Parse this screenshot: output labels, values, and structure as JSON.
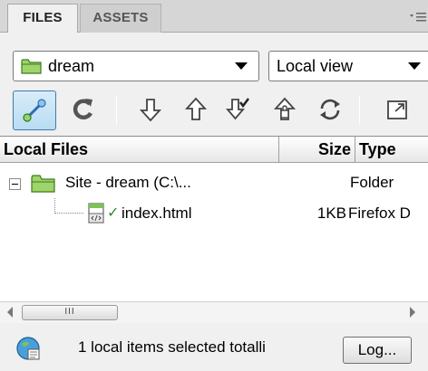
{
  "tabs": [
    {
      "label": "FILES",
      "active": true
    },
    {
      "label": "ASSETS",
      "active": false
    }
  ],
  "site_select": {
    "value": "dream",
    "icon": "folder-icon"
  },
  "view_select": {
    "value": "Local view"
  },
  "toolbar": {
    "buttons": [
      {
        "name": "connect-icon",
        "active": true
      },
      {
        "name": "refresh-icon"
      },
      {
        "name": "get-files-icon"
      },
      {
        "name": "put-files-icon"
      },
      {
        "name": "check-out-icon"
      },
      {
        "name": "check-in-icon"
      },
      {
        "name": "synchronize-icon"
      },
      {
        "name": "expand-icon"
      }
    ]
  },
  "columns": {
    "name": "Local Files",
    "size": "Size",
    "type": "Type"
  },
  "rows": [
    {
      "name": "Site - dream (C:\\...",
      "size": "",
      "type": "Folder",
      "expanded": true
    },
    {
      "name": "index.html",
      "size": "1KB",
      "type": "Firefox D",
      "checked": true
    }
  ],
  "scrollbar": {
    "thumb_label": "III"
  },
  "status": {
    "text": "1 local items selected totalli",
    "log_button": "Log..."
  },
  "colors": {
    "accent": "#3d7bad",
    "folder": "#7ec24a",
    "checkmark": "#2c8c2c"
  }
}
